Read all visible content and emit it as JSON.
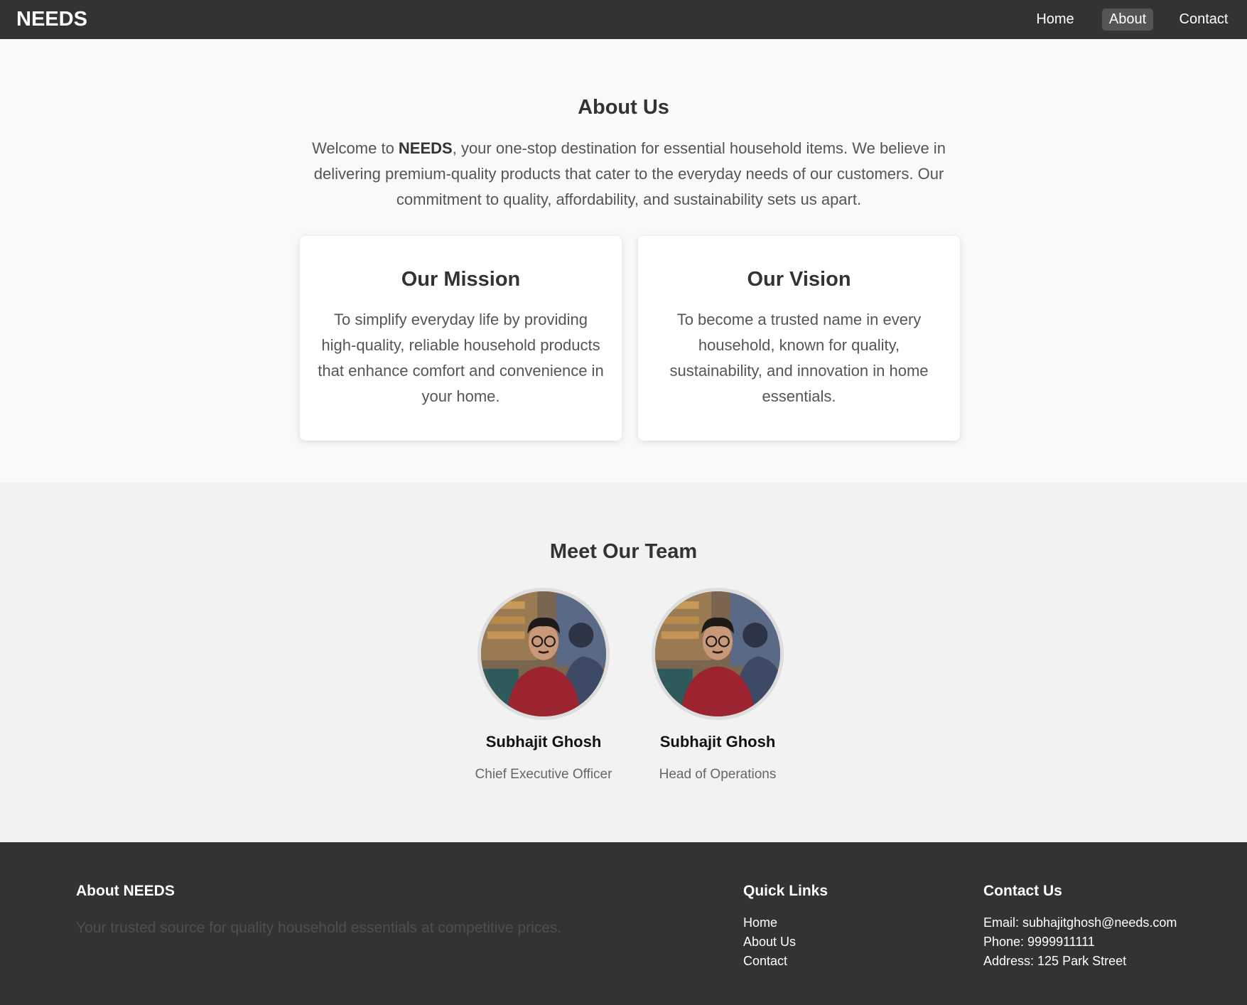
{
  "navbar": {
    "brand": "NEEDS",
    "links": [
      "Home",
      "About",
      "Contact"
    ],
    "active_link": "About"
  },
  "about": {
    "title": "About Us",
    "intro_prefix": "Welcome to ",
    "intro_brand": "NEEDS",
    "intro_rest": ", your one-stop destination for essential household items. We believe in delivering premium-quality products that cater to the everyday needs of our customers. Our commitment to quality, affordability, and sustainability sets us apart.",
    "mission": {
      "title": "Our Mission",
      "text": "To simplify everyday life by providing high-quality, reliable household products that enhance comfort and convenience in your home."
    },
    "vision": {
      "title": "Our Vision",
      "text": "To become a trusted name in every household, known for quality, sustainability, and innovation in home essentials."
    }
  },
  "team": {
    "title": "Meet Our Team",
    "members": [
      {
        "name": "Subhajit Ghosh",
        "role": "Chief Executive Officer"
      },
      {
        "name": "Subhajit Ghosh",
        "role": "Head of Operations"
      }
    ]
  },
  "footer": {
    "about_title": "About NEEDS",
    "about_text": "Your trusted source for quality household essentials at competitive prices.",
    "links_title": "Quick Links",
    "links": [
      "Home",
      "About Us",
      "Contact"
    ],
    "contact_title": "Contact Us",
    "contact_lines": [
      "Email: subhajitghosh@needs.com",
      "Phone: 9999911111",
      "Address: 125 Park Street"
    ]
  },
  "colors": {
    "navbar_bg": "#333333",
    "active_link_bg": "#555555",
    "page_bg": "#f9f9f9",
    "team_bg": "#f2f2f2",
    "footer_bg": "#333333"
  }
}
